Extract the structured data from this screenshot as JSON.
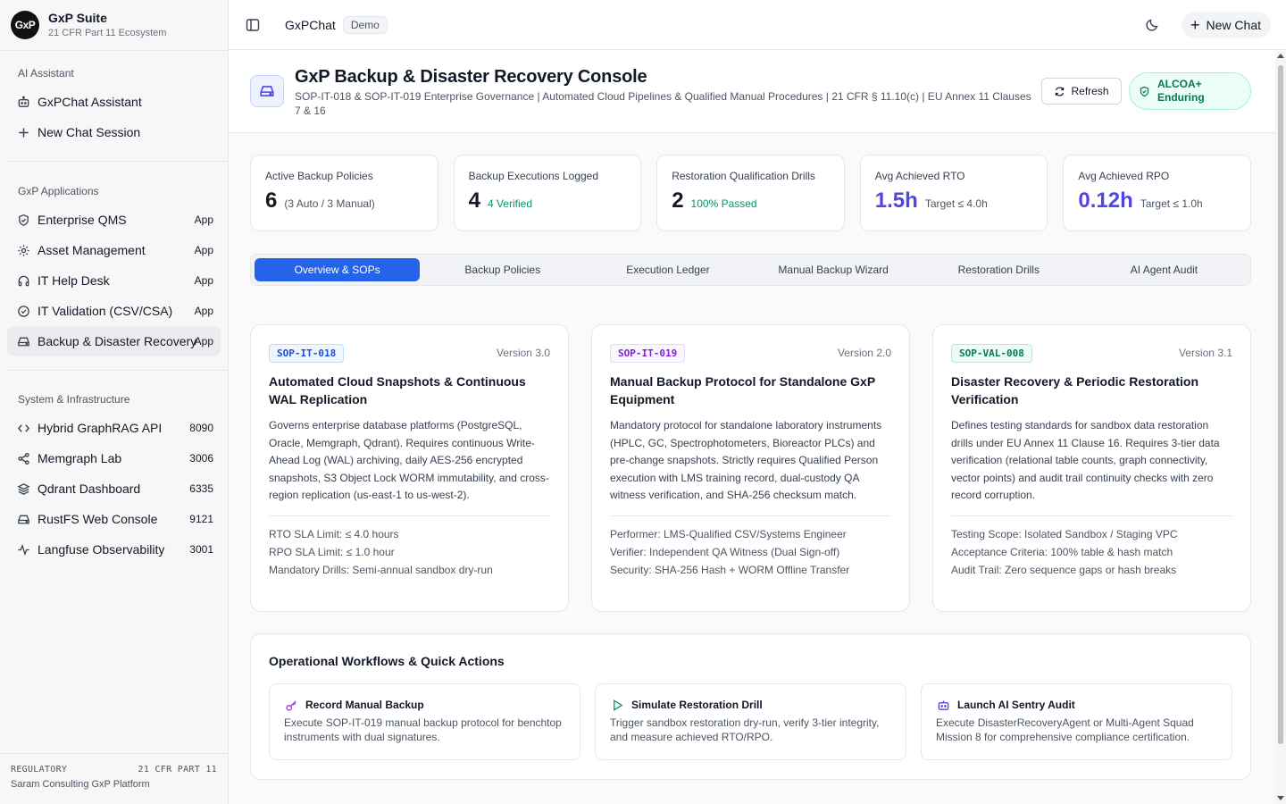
{
  "brand": {
    "logo": "GxP",
    "name": "GxP Suite",
    "subtitle": "21 CFR Part 11 Ecosystem"
  },
  "sidebar": {
    "sections": [
      {
        "title": "AI Assistant",
        "items": [
          {
            "label": "GxPChat Assistant",
            "icon": "robot-icon",
            "badge": ""
          },
          {
            "label": "New Chat Session",
            "icon": "plus-icon",
            "badge": ""
          }
        ]
      },
      {
        "title": "GxP Applications",
        "items": [
          {
            "label": "Enterprise QMS",
            "icon": "shield-icon",
            "badge": "App"
          },
          {
            "label": "Asset Management",
            "icon": "gear-icon",
            "badge": "App"
          },
          {
            "label": "IT Help Desk",
            "icon": "headphones-icon",
            "badge": "App"
          },
          {
            "label": "IT Validation (CSV/CSA)",
            "icon": "check-circle-icon",
            "badge": "App"
          },
          {
            "label": "Backup & Disaster Recovery",
            "icon": "hard-drive-icon",
            "badge": "App"
          }
        ]
      },
      {
        "title": "System & Infrastructure",
        "items": [
          {
            "label": "Hybrid GraphRAG API",
            "icon": "code-icon",
            "badge": "8090"
          },
          {
            "label": "Memgraph Lab",
            "icon": "share-icon",
            "badge": "3006"
          },
          {
            "label": "Qdrant Dashboard",
            "icon": "layers-icon",
            "badge": "6335"
          },
          {
            "label": "RustFS Web Console",
            "icon": "hard-drive-icon",
            "badge": "9121"
          },
          {
            "label": "Langfuse Observability",
            "icon": "activity-icon",
            "badge": "3001"
          }
        ]
      }
    ],
    "footer": {
      "left": "REGULATORY",
      "right": "21 CFR PART 11",
      "org": "Saram Consulting GxP Platform"
    }
  },
  "topbar": {
    "title": "GxPChat",
    "badge": "Demo",
    "new_chat": "New Chat"
  },
  "header": {
    "title": "GxP Backup & Disaster Recovery Console",
    "subtitle": "SOP-IT-018 & SOP-IT-019 Enterprise Governance | Automated Cloud Pipelines & Qualified Manual Procedures | 21 CFR § 11.10(c) | EU Annex 11 Clauses 7 & 16",
    "refresh": "Refresh",
    "status_line1": "ALCOA+",
    "status_line2": "Enduring"
  },
  "stats": [
    {
      "label": "Active Backup Policies",
      "value": "6",
      "note": "(3 Auto / 3 Manual)",
      "value_color": "dark",
      "note_color": "gray"
    },
    {
      "label": "Backup Executions Logged",
      "value": "4",
      "note": "4 Verified",
      "value_color": "dark",
      "note_color": "green"
    },
    {
      "label": "Restoration Qualification Drills",
      "value": "2",
      "note": "100% Passed",
      "value_color": "dark",
      "note_color": "green"
    },
    {
      "label": "Avg Achieved RTO",
      "value": "1.5h",
      "note": "Target ≤ 4.0h",
      "value_color": "indigo",
      "note_color": "gray"
    },
    {
      "label": "Avg Achieved RPO",
      "value": "0.12h",
      "note": "Target ≤ 1.0h",
      "value_color": "indigo",
      "note_color": "gray"
    }
  ],
  "tabs": [
    "Overview & SOPs",
    "Backup Policies",
    "Execution Ledger",
    "Manual Backup Wizard",
    "Restoration Drills",
    "AI Agent Audit"
  ],
  "sops": [
    {
      "code": "SOP-IT-018",
      "version": "Version 3.0",
      "color": "blue",
      "title": "Automated Cloud Snapshots & Continuous WAL Replication",
      "body": "Governs enterprise database platforms (PostgreSQL, Oracle, Memgraph, Qdrant). Requires continuous Write-Ahead Log (WAL) archiving, daily AES-256 encrypted snapshots, S3 Object Lock WORM immutability, and cross-region replication (us-east-1 to us-west-2).",
      "meta": [
        "RTO SLA Limit: ≤ 4.0 hours",
        "RPO SLA Limit: ≤ 1.0 hour",
        "Mandatory Drills: Semi-annual sandbox dry-run"
      ]
    },
    {
      "code": "SOP-IT-019",
      "version": "Version 2.0",
      "color": "purple",
      "title": "Manual Backup Protocol for Standalone GxP Equipment",
      "body": "Mandatory protocol for standalone laboratory instruments (HPLC, GC, Spectrophotometers, Bioreactor PLCs) and pre-change snapshots. Strictly requires Qualified Person execution with LMS training record, dual-custody QA witness verification, and SHA-256 checksum match.",
      "meta": [
        "Performer: LMS-Qualified CSV/Systems Engineer",
        "Verifier: Independent QA Witness (Dual Sign-off)",
        "Security: SHA-256 Hash + WORM Offline Transfer"
      ]
    },
    {
      "code": "SOP-VAL-008",
      "version": "Version 3.1",
      "color": "green",
      "title": "Disaster Recovery & Periodic Restoration Verification",
      "body": "Defines testing standards for sandbox data restoration drills under EU Annex 11 Clause 16. Requires 3-tier data verification (relational table counts, graph connectivity, vector points) and audit trail continuity checks with zero record corruption.",
      "meta": [
        "Testing Scope: Isolated Sandbox / Staging VPC",
        "Acceptance Criteria: 100% table & hash match",
        "Audit Trail: Zero sequence gaps or hash breaks"
      ]
    }
  ],
  "workflows": {
    "title": "Operational Workflows & Quick Actions",
    "cards": [
      {
        "name": "Record Manual Backup",
        "icon": "key-icon",
        "desc": "Execute SOP-IT-019 manual backup protocol for benchtop instruments with dual signatures."
      },
      {
        "name": "Simulate Restoration Drill",
        "icon": "play-icon",
        "desc": "Trigger sandbox restoration dry-run, verify 3-tier integrity, and measure achieved RTO/RPO."
      },
      {
        "name": "Launch AI Sentry Audit",
        "icon": "robot-icon",
        "desc": "Execute DisasterRecoveryAgent or Multi-Agent Squad Mission 8 for comprehensive compliance certification."
      }
    ]
  },
  "colors": {
    "accent": "#2563eb",
    "indigo": "#4f46e5",
    "success": "#059669"
  }
}
